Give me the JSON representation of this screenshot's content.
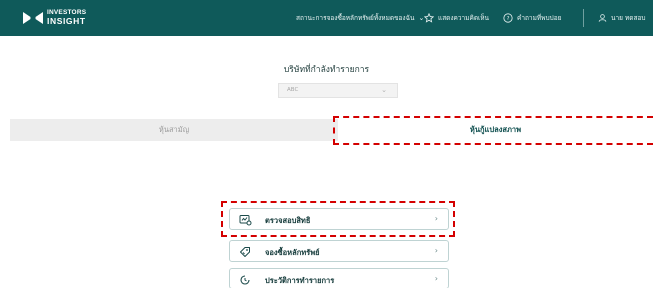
{
  "header": {
    "logo_line1": "INVESTORS",
    "logo_line2": "INSIGHT",
    "nav_status": "สถานะการจองซื้อหลักทรัพย์ทั้งหมดของฉัน",
    "nav_feedback": "แสดงความคิดเห็น",
    "nav_help": "คำถามที่พบบ่อย",
    "nav_user": "นาย ทดสอบ"
  },
  "company": {
    "label": "บริษัทที่กำลังทำรายการ",
    "selected": "ABC"
  },
  "tabs": [
    {
      "label": "หุ้นสามัญ",
      "active": false
    },
    {
      "label": "หุ้นกู้แปลงสภาพ",
      "active": true
    }
  ],
  "menu": [
    {
      "label": "ตรวจสอบสิทธิ",
      "icon": "verify-document-icon"
    },
    {
      "label": "จองซื้อหลักทรัพย์",
      "icon": "tag-icon"
    },
    {
      "label": "ประวัติการทำรายการ",
      "icon": "history-clock-icon"
    }
  ],
  "colors": {
    "header_bg": "#0f5a5a",
    "highlight": "#d40000",
    "tab_inactive_bg": "#ededed"
  }
}
